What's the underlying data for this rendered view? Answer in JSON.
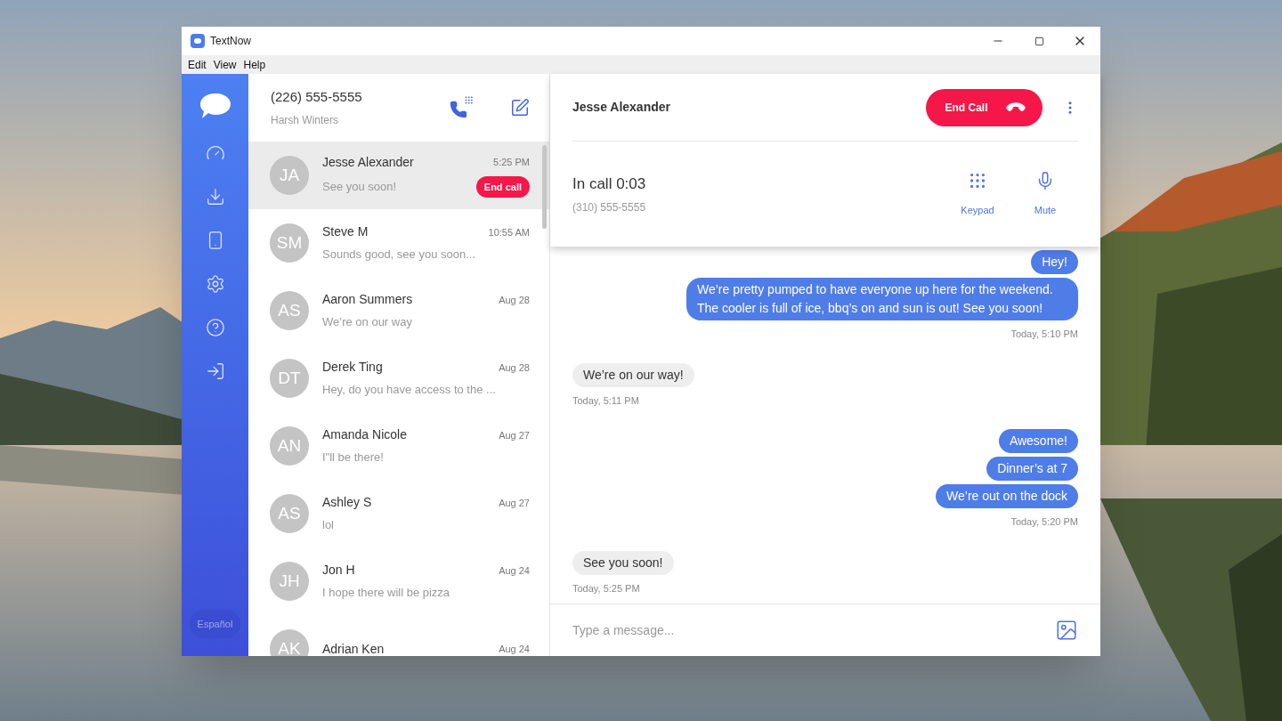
{
  "window": {
    "title": "TextNow"
  },
  "menu": [
    "Edit",
    "View",
    "Help"
  ],
  "sidebar": {
    "language_button": "Español"
  },
  "account": {
    "phone": "(226) 555-5555",
    "name": "Harsh Winters"
  },
  "conversations": [
    {
      "initials": "JA",
      "name": "Jesse Alexander",
      "time": "5:25 PM",
      "preview": "See you soon!",
      "selected": true,
      "badge": "End call"
    },
    {
      "initials": "SM",
      "name": "Steve M",
      "time": "10:55 AM",
      "preview": "Sounds good, see you soon...",
      "selected": false
    },
    {
      "initials": "AS",
      "name": "Aaron Summers",
      "time": "Aug 28",
      "preview": "We’re on our way",
      "selected": false
    },
    {
      "initials": "DT",
      "name": "Derek Ting",
      "time": "Aug 28",
      "preview": "Hey, do you have access to the ...",
      "selected": false
    },
    {
      "initials": "AN",
      "name": "Amanda Nicole",
      "time": "Aug 27",
      "preview": "I\"ll be there!",
      "selected": false
    },
    {
      "initials": "AS",
      "name": "Ashley S",
      "time": "Aug 27",
      "preview": "lol",
      "selected": false
    },
    {
      "initials": "JH",
      "name": "Jon H",
      "time": "Aug 24",
      "preview": "I hope there will be pizza",
      "selected": false
    },
    {
      "initials": "AK",
      "name": "Adrian Ken",
      "time": "Aug 24",
      "selected": false
    }
  ],
  "chat": {
    "contact": "Jesse Alexander",
    "end_call_button": "End Call",
    "call": {
      "status": "In call 0:03",
      "number": "(310) 555-5555",
      "actions": [
        {
          "kind": "keypad",
          "label": "Keypad"
        },
        {
          "kind": "mute",
          "label": "Mute"
        }
      ]
    },
    "groups": [
      {
        "kind": "sent",
        "bubbles": [
          "Hey!",
          "We’re pretty pumped to have everyone up here for the weekend. The cooler is full of ice, bbq’s on and sun is out!  See you soon!"
        ],
        "time": "Today, 5:10 PM"
      },
      {
        "kind": "received",
        "bubbles": [
          "We’re on our way!"
        ],
        "time": "Today, 5:11 PM"
      },
      {
        "kind": "sent",
        "bubbles": [
          "Awesome!",
          "Dinner’s at 7",
          "We’re out on the dock"
        ],
        "time": "Today, 5:20 PM"
      },
      {
        "kind": "received",
        "bubbles": [
          "See you soon!"
        ],
        "time": "Today, 5:25 PM"
      }
    ],
    "composer": {
      "placeholder": "Type a message..."
    }
  }
}
